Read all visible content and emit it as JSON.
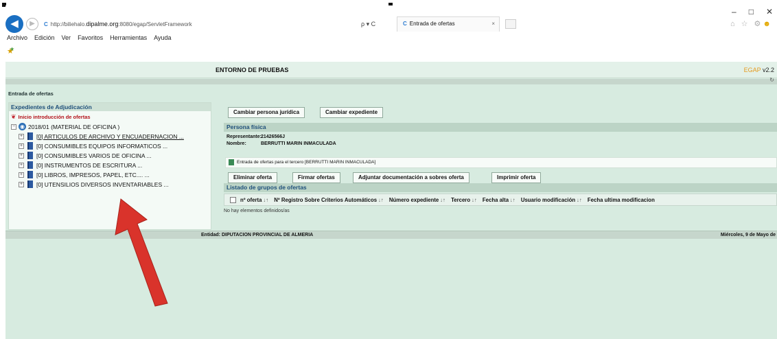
{
  "browser": {
    "window_controls": [
      "–",
      "□",
      "✕"
    ],
    "back_symbol": "◀",
    "forward_symbol": "▶",
    "address_prefix": "http://",
    "address_host_a": "biliehalo.",
    "address_host_b": "dipalme.org",
    "address_path": ":8080/egap/ServletFramework",
    "address_controls": "ρ ▾ C",
    "tab_title": "Entrada de ofertas",
    "tab_close": "×",
    "toolbar_icons": "⌂ ☆ ⚙",
    "smile_icon": "☻",
    "menu": [
      "Archivo",
      "Edición",
      "Ver",
      "Favoritos",
      "Herramientas",
      "Ayuda"
    ]
  },
  "header": {
    "environment": "ENTORNO DE PRUEBAS",
    "app_name": "EGAP",
    "version": "v2.2",
    "refresh": "↻"
  },
  "breadcrumb": "Entrada de ofertas",
  "sidebar": {
    "title": "Expedientes de Adjudicación",
    "start_link": "Inicio introducción de ofertas",
    "root": {
      "label": "2018/01 (MATERIAL DE OFICINA )",
      "expander": "−"
    },
    "items": [
      {
        "label": "[0] ARTICULOS DE ARCHIVO Y ENCUADERNACION ...",
        "expander": "+"
      },
      {
        "label": "[0] CONSUMIBLES EQUIPOS INFORMATICOS ...",
        "expander": "+"
      },
      {
        "label": "[0] CONSUMIBLES VARIOS DE OFICINA ...",
        "expander": "+"
      },
      {
        "label": "[0] INSTRUMENTOS DE ESCRITURA ...",
        "expander": "+"
      },
      {
        "label": "[0] LIBROS, IMPRESOS, PAPEL, ETC.... ...",
        "expander": "+"
      },
      {
        "label": "[0] UTENSILIOS DIVERSOS INVENTARIABLES ...",
        "expander": "+"
      }
    ]
  },
  "main": {
    "btn_cambiar_persona": "Cambiar persona jurídica",
    "btn_cambiar_expediente": "Cambiar expediente",
    "persona_title": "Persona física",
    "representante_label": "Representante:",
    "representante_value": "21426566J",
    "nombre_label": "Nombre:",
    "nombre_value": "BERRUTTI MARIN INMACULADA",
    "info_text": "Entrada de ofertas para el tercero [BERRUTTI MARIN INMACULADA]",
    "btn_eliminar": "Eliminar oferta",
    "btn_firmar": "Firmar ofertas",
    "btn_adjuntar": "Adjuntar documentación a sobres oferta",
    "btn_imprimir": "Imprimir oferta",
    "listado_title": "Listado de grupos de ofertas",
    "sort_symbol": "↓↑",
    "columns": [
      "nº oferta",
      "Nº Registro Sobre Criterios Automáticos",
      "Número expediente",
      "Tercero",
      "Fecha alta",
      "Usuario modificación",
      "Fecha ultima modificacion"
    ],
    "empty_text": "No hay elementos definidos/as"
  },
  "footer": {
    "entity": "Entidad: DIPUTACION PROVINCIAL DE ALMERIA",
    "date": "Miércoles, 9 de Mayo de"
  },
  "colors": {
    "accent": "#1e4f7a",
    "page_bg": "#d7ebe0",
    "annotation_arrow": "#d9332b"
  }
}
